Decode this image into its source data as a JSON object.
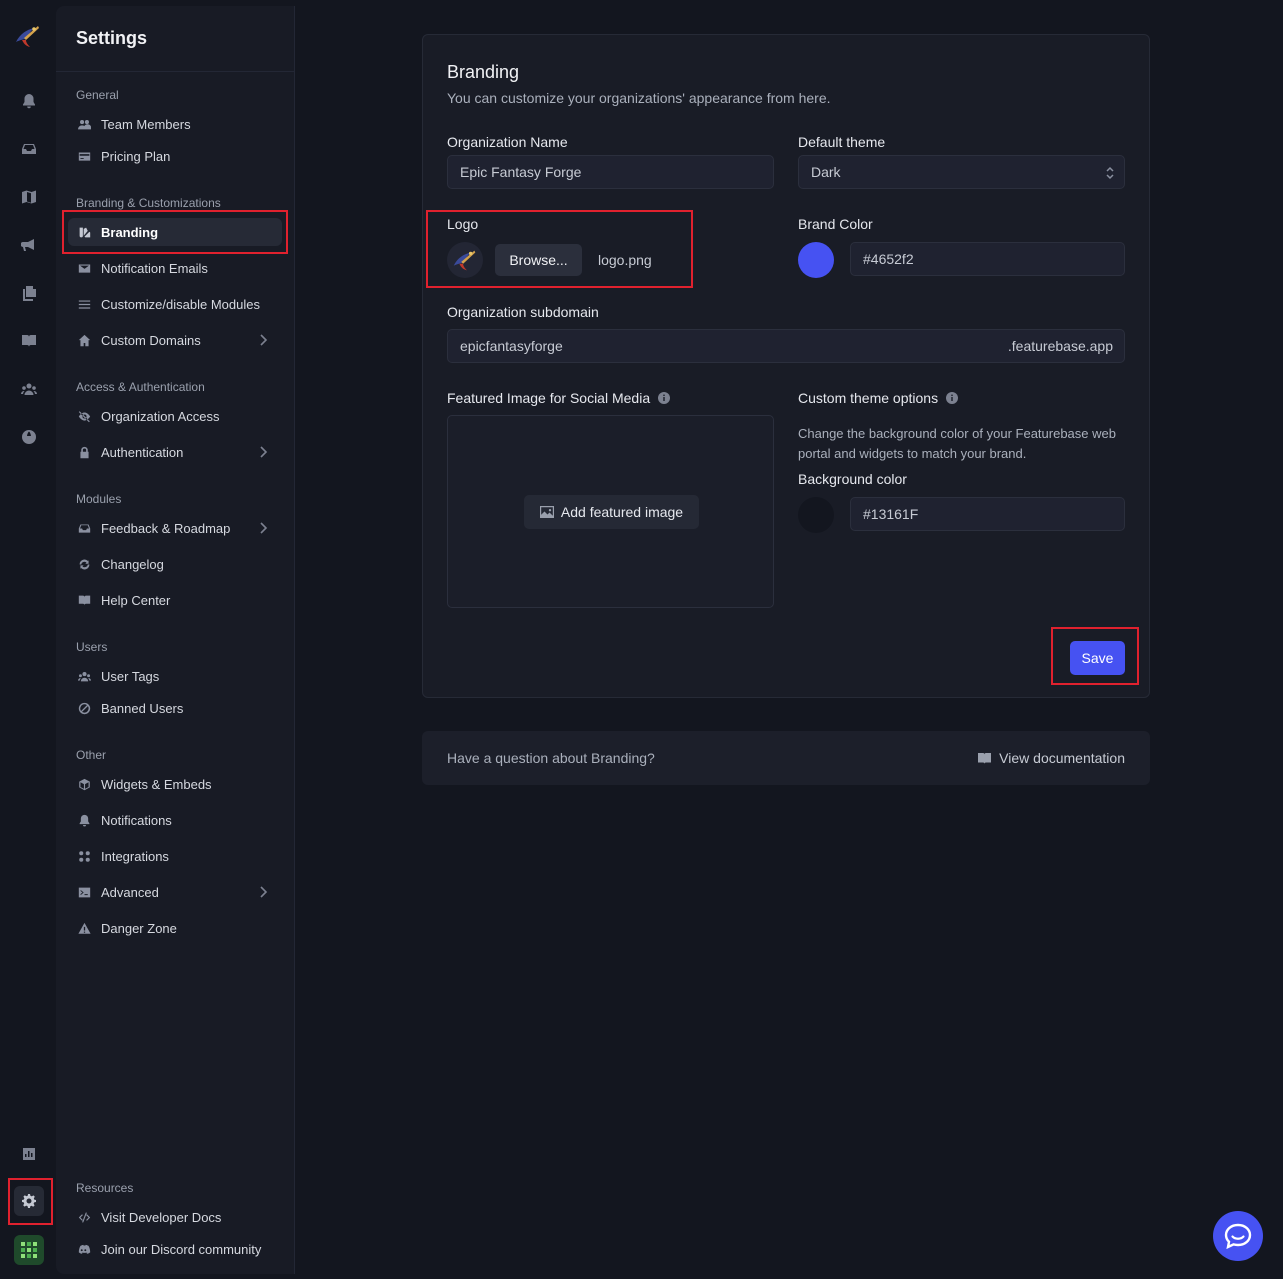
{
  "sidebar": {
    "title": "Settings",
    "sections": {
      "general": "General",
      "branding": "Branding & Customizations",
      "access": "Access & Authentication",
      "modules": "Modules",
      "users": "Users",
      "other": "Other",
      "resources": "Resources"
    },
    "items": {
      "team_members": "Team Members",
      "pricing_plan": "Pricing Plan",
      "branding": "Branding",
      "notification_emails": "Notification Emails",
      "customize_modules": "Customize/disable Modules",
      "custom_domains": "Custom Domains",
      "organization_access": "Organization Access",
      "authentication": "Authentication",
      "feedback_roadmap": "Feedback & Roadmap",
      "changelog": "Changelog",
      "help_center": "Help Center",
      "user_tags": "User Tags",
      "banned_users": "Banned Users",
      "widgets_embeds": "Widgets & Embeds",
      "notifications": "Notifications",
      "integrations": "Integrations",
      "advanced": "Advanced",
      "danger_zone": "Danger Zone",
      "developer_docs": "Visit Developer Docs",
      "discord": "Join our Discord community"
    }
  },
  "branding": {
    "title": "Branding",
    "subtitle": "You can customize your organizations' appearance from here.",
    "org_name_label": "Organization Name",
    "org_name_value": "Epic Fantasy Forge",
    "theme_label": "Default theme",
    "theme_value": "Dark",
    "logo_label": "Logo",
    "browse_label": "Browse...",
    "logo_file": "logo.png",
    "brand_color_label": "Brand Color",
    "brand_color_value": "#4652f2",
    "subdomain_label": "Organization subdomain",
    "subdomain_value": "epicfantasyforge",
    "subdomain_suffix": ".featurebase.app",
    "featured_image_label": "Featured Image for Social Media",
    "add_image_label": "Add featured image",
    "custom_theme_label": "Custom theme options",
    "custom_theme_help": "Change the background color of your Featurebase web portal and widgets to match your brand.",
    "bg_color_label": "Background color",
    "bg_color_value": "#13161F",
    "save_label": "Save"
  },
  "docs": {
    "question": "Have a question about Branding?",
    "link": "View documentation"
  },
  "colors": {
    "accent": "#4652f2",
    "background": "#13161f",
    "highlight": "#e0212e"
  }
}
